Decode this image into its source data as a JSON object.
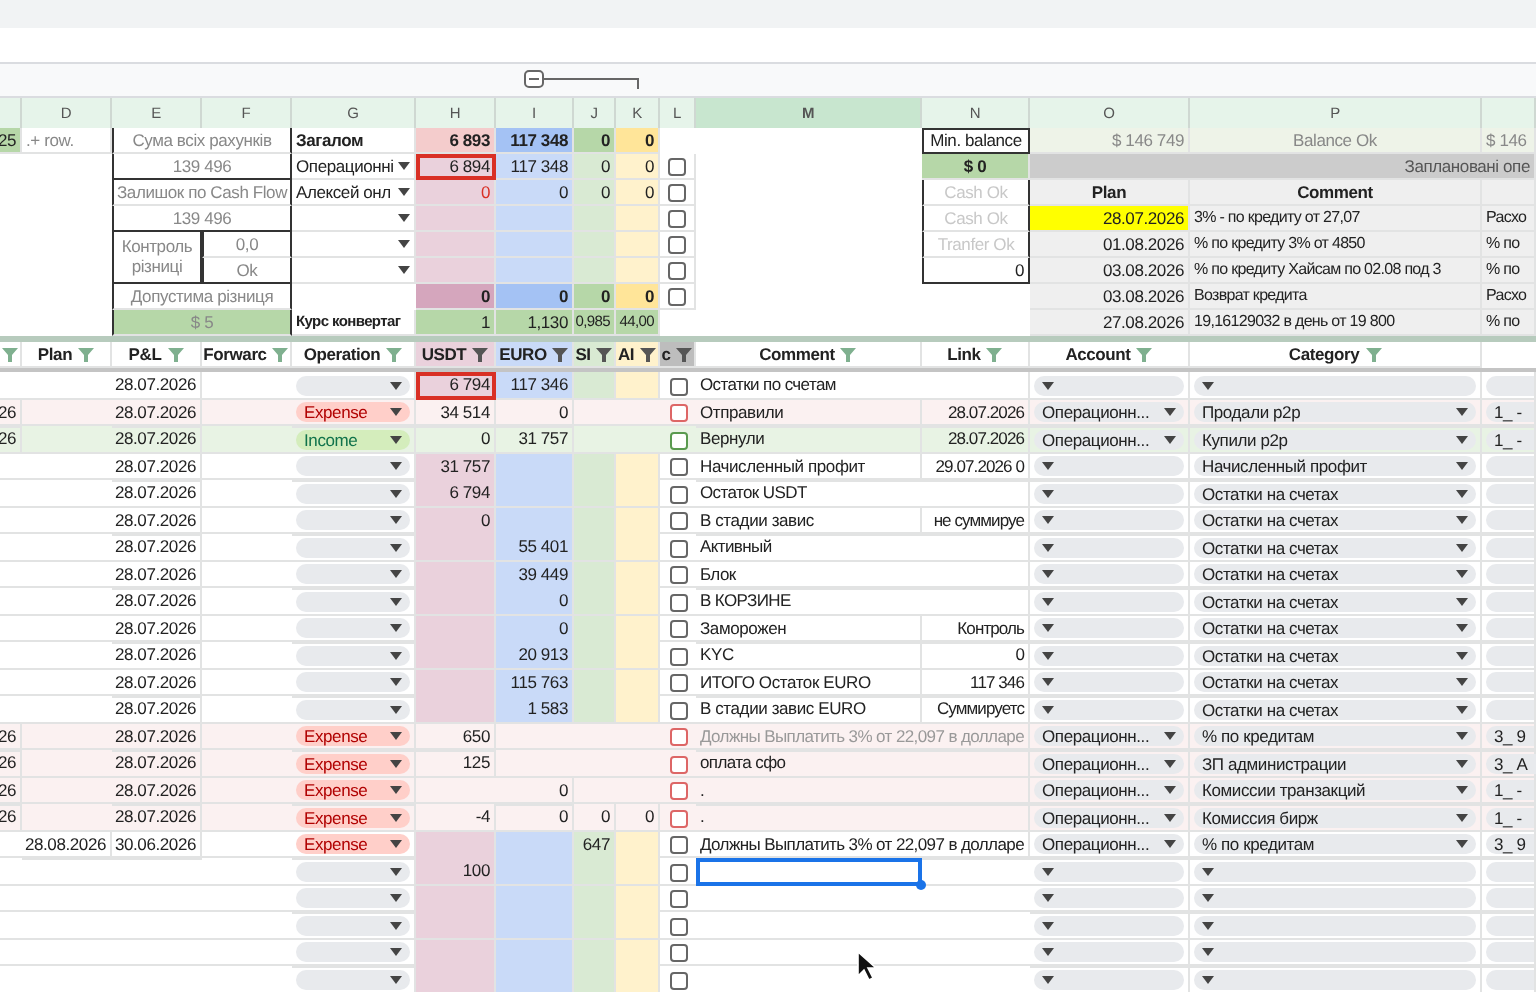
{
  "column_letters": [
    "D",
    "E",
    "F",
    "G",
    "H",
    "I",
    "J",
    "K",
    "L",
    "M",
    "N",
    "O",
    "P"
  ],
  "edge": {
    "column_c": "25",
    "column_d": ".+ row."
  },
  "balance_panel": [
    {
      "kind": "label",
      "text": "Сума всіх рахунків"
    },
    {
      "kind": "value",
      "text": "139 496"
    },
    {
      "kind": "label",
      "text": "Залишок по Cash Flow"
    },
    {
      "kind": "value",
      "text": "139 496"
    },
    {
      "kind": "check",
      "label": "Контроль різниці",
      "values": [
        "0,0",
        "Ok"
      ]
    },
    {
      "kind": "label",
      "text": "Допустима різниця"
    },
    {
      "kind": "total",
      "text": "$ 5"
    }
  ],
  "accounts": [
    {
      "kind": "total",
      "label": "Загалом",
      "values": [
        "6 893",
        "117 348",
        "0",
        "0"
      ]
    },
    {
      "kind": "account",
      "label": "Операционні",
      "values": [
        "6 894",
        "117 348",
        "0",
        "0"
      ],
      "highlighted": true,
      "alert": false,
      "checked": false
    },
    {
      "kind": "account",
      "label": "Алексей онл",
      "values": [
        "0",
        "0",
        "0",
        "0"
      ],
      "highlighted": false,
      "alert": true,
      "checked": false
    },
    {
      "kind": "account",
      "checked": false
    },
    {
      "kind": "account",
      "checked": false
    },
    {
      "kind": "account",
      "checked": false
    },
    {
      "kind": "difference",
      "values": [
        "0",
        "0",
        "0",
        "0"
      ],
      "checked": false
    },
    {
      "kind": "rate",
      "label": "Курс конвертаг",
      "values": [
        "1",
        "1,130",
        "0,985",
        "44,00"
      ]
    }
  ],
  "status_panel": [
    {
      "kind": "header",
      "text": "Min. balance"
    },
    {
      "kind": "total",
      "text": "$ 0"
    },
    {
      "kind": "status",
      "text": "Cash Ok"
    },
    {
      "kind": "status",
      "text": "Cash Ok"
    },
    {
      "kind": "status",
      "text": "Tranfer Ok"
    },
    {
      "kind": "value",
      "text": "0"
    }
  ],
  "planned": {
    "balance": "$ 146 749",
    "status": "Balance Ok",
    "next": "$ 146",
    "title": "Заплановані опе",
    "columns": [
      "Plan",
      "Comment"
    ],
    "items": [
      {
        "plan": "28.07.2026",
        "comment": "3% - по кредиту от 27,07",
        "category": "Расхо",
        "due": true
      },
      {
        "plan": "01.08.2026",
        "comment": "% по кредиту 3% от 4850",
        "category": "% по",
        "due": false
      },
      {
        "plan": "03.08.2026",
        "comment": "% по кредиту Хайсам по 02.08 под 3",
        "category": "% по",
        "due": false
      },
      {
        "plan": "03.08.2026",
        "comment": "Возврат кредита",
        "category": "Расхо",
        "due": false
      },
      {
        "plan": "27.08.2026",
        "comment": "19,16129032 в день от 19 800",
        "category": "% по",
        "due": false
      }
    ]
  },
  "table": {
    "columns": [
      "Plan",
      "P&L",
      "Forwarc",
      "Operation",
      "USDT",
      "EURO",
      "SI",
      "AI",
      "c",
      "Comment",
      "Link",
      "Account",
      "Category"
    ],
    "rows": [
      {
        "pnl": "28.07.2026",
        "operation": {
          "kind": "none"
        },
        "usdt": "6 794",
        "euro": "117 346",
        "comment": "Остатки по счетам",
        "checked": false,
        "posted": false,
        "highlighted": true,
        "muted": false,
        "selected": false
      },
      {
        "column_c": "26",
        "pnl": "28.07.2026",
        "operation": {
          "kind": "expense",
          "label": "Expense"
        },
        "usdt": "34 514",
        "euro": "0",
        "comment": "Отправили",
        "link": "28.07.2026",
        "account": "Операционн...",
        "category": "Продали p2p",
        "column_q": "1_ -",
        "checked": false,
        "posted": true,
        "highlighted": false,
        "muted": false,
        "selected": false
      },
      {
        "column_c": "26",
        "pnl": "28.07.2026",
        "operation": {
          "kind": "income",
          "label": "Income"
        },
        "usdt": "0",
        "euro": "31 757",
        "comment": "Вернули",
        "link": "28.07.2026",
        "account": "Операционн...",
        "category": "Купили p2p",
        "column_q": "1_ -",
        "checked": false,
        "posted": true,
        "highlighted": false,
        "muted": false,
        "selected": false
      },
      {
        "pnl": "28.07.2026",
        "operation": {
          "kind": "none"
        },
        "usdt": "31 757",
        "comment": "Начисленный профит",
        "link": "29.07.2026 0",
        "category": "Начисленный профит",
        "checked": false,
        "posted": false,
        "highlighted": false,
        "muted": false,
        "selected": false
      },
      {
        "pnl": "28.07.2026",
        "operation": {
          "kind": "none"
        },
        "usdt": "6 794",
        "comment": "Остаток USDT",
        "category": "Остатки на счетах",
        "checked": false,
        "posted": false,
        "highlighted": false,
        "muted": false,
        "selected": false
      },
      {
        "pnl": "28.07.2026",
        "operation": {
          "kind": "none"
        },
        "usdt": "0",
        "comment": "В стадии завис",
        "link": "не суммируе",
        "category": "Остатки на счетах",
        "checked": false,
        "posted": false,
        "highlighted": false,
        "muted": false,
        "selected": false
      },
      {
        "pnl": "28.07.2026",
        "operation": {
          "kind": "none"
        },
        "euro": "55 401",
        "comment": "Активный",
        "category": "Остатки на счетах",
        "checked": false,
        "posted": false,
        "highlighted": false,
        "muted": false,
        "selected": false
      },
      {
        "pnl": "28.07.2026",
        "operation": {
          "kind": "none"
        },
        "euro": "39 449",
        "comment": "Блок",
        "category": "Остатки на счетах",
        "checked": false,
        "posted": false,
        "highlighted": false,
        "muted": false,
        "selected": false
      },
      {
        "pnl": "28.07.2026",
        "operation": {
          "kind": "none"
        },
        "euro": "0",
        "comment": "В КОРЗИНЕ",
        "category": "Остатки на счетах",
        "checked": false,
        "posted": false,
        "highlighted": false,
        "muted": false,
        "selected": false
      },
      {
        "pnl": "28.07.2026",
        "operation": {
          "kind": "none"
        },
        "euro": "0",
        "comment": "Заморожен",
        "link": "Контроль",
        "category": "Остатки на счетах",
        "checked": false,
        "posted": false,
        "highlighted": false,
        "muted": false,
        "selected": false
      },
      {
        "pnl": "28.07.2026",
        "operation": {
          "kind": "none"
        },
        "euro": "20 913",
        "comment": "KYC",
        "link": "0",
        "category": "Остатки на счетах",
        "checked": false,
        "posted": false,
        "highlighted": false,
        "muted": false,
        "selected": false
      },
      {
        "pnl": "28.07.2026",
        "operation": {
          "kind": "none"
        },
        "euro": "115 763",
        "comment": "ИТОГО Остаток EURO",
        "link": "117 346",
        "category": "Остатки на счетах",
        "checked": false,
        "posted": false,
        "highlighted": false,
        "muted": false,
        "selected": false
      },
      {
        "pnl": "28.07.2026",
        "operation": {
          "kind": "none"
        },
        "euro": "1 583",
        "comment": "В стадии завис EURO",
        "link": "Суммируетс",
        "category": "Остатки на счетах",
        "checked": false,
        "posted": false,
        "highlighted": false,
        "muted": false,
        "selected": false
      },
      {
        "column_c": "26",
        "pnl": "28.07.2026",
        "operation": {
          "kind": "expense",
          "label": "Expense"
        },
        "usdt": "650",
        "comment": "Должны Выплатить 3% от 22,097 в долларе",
        "account": "Операционн...",
        "category": "% по кредитам",
        "column_q": "3_ 9",
        "checked": false,
        "posted": true,
        "highlighted": false,
        "muted": true,
        "selected": false
      },
      {
        "column_c": "26",
        "pnl": "28.07.2026",
        "operation": {
          "kind": "expense",
          "label": "Expense"
        },
        "usdt": "125",
        "comment": "оплата сфо",
        "account": "Операционн...",
        "category": "ЗП администрации",
        "column_q": "3_ А",
        "checked": false,
        "posted": true,
        "highlighted": false,
        "muted": false,
        "selected": false
      },
      {
        "column_c": "26",
        "pnl": "28.07.2026",
        "operation": {
          "kind": "expense",
          "label": "Expense"
        },
        "euro": "0",
        "comment": ".",
        "account": "Операционн...",
        "category": "Комиссии транзакций",
        "column_q": "1_ -",
        "checked": false,
        "posted": true,
        "highlighted": false,
        "muted": false,
        "selected": false
      },
      {
        "column_c": "26",
        "pnl": "28.07.2026",
        "operation": {
          "kind": "expense",
          "label": "Expense"
        },
        "usdt": "-4",
        "euro": "0",
        "column_j": "0",
        "column_k": "0",
        "comment": ".",
        "account": "Операционн...",
        "category": "Комиссия бирж",
        "column_q": "1_ -",
        "checked": false,
        "posted": true,
        "highlighted": false,
        "muted": false,
        "selected": false
      },
      {
        "plan": "28.08.2026",
        "pnl": "30.06.2026",
        "operation": {
          "kind": "expense",
          "label": "Expense"
        },
        "column_j": "647",
        "comment": "Должны Выплатить 3% от 22,097 в долларе",
        "account": "Операционн...",
        "category": "% по кредитам",
        "column_q": "3_ 9",
        "checked": false,
        "posted": false,
        "highlighted": false,
        "muted": false,
        "selected": false
      },
      {
        "operation": {
          "kind": "none"
        },
        "usdt": "100",
        "checked": false,
        "posted": false,
        "highlighted": false,
        "selected": true
      },
      {
        "operation": {
          "kind": "none"
        },
        "checked": false,
        "posted": false,
        "highlighted": false,
        "selected": false
      },
      {
        "operation": {
          "kind": "none"
        },
        "checked": false,
        "posted": false,
        "highlighted": false,
        "selected": false
      },
      {
        "operation": {
          "kind": "none"
        },
        "checked": false,
        "posted": false,
        "highlighted": false,
        "selected": false
      },
      {
        "operation": {
          "kind": "none"
        },
        "checked": false,
        "posted": false,
        "highlighted": false,
        "selected": false
      }
    ]
  }
}
